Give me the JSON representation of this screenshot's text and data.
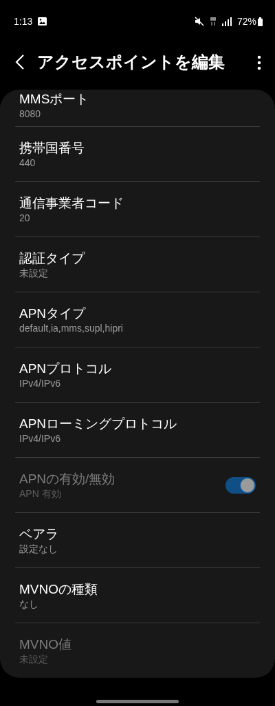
{
  "status_bar": {
    "time": "1:13",
    "battery": "72%"
  },
  "header": {
    "title": "アクセスポイントを編集"
  },
  "items": [
    {
      "kind": "text",
      "label": "MMSポート",
      "value": "8080",
      "disabled": false
    },
    {
      "kind": "text",
      "label": "携帯国番号",
      "value": "440",
      "disabled": false
    },
    {
      "kind": "text",
      "label": "通信事業者コード",
      "value": "20",
      "disabled": false
    },
    {
      "kind": "text",
      "label": "認証タイプ",
      "value": "未設定",
      "disabled": false
    },
    {
      "kind": "text",
      "label": "APNタイプ",
      "value": "default,ia,mms,supl,hipri",
      "disabled": false
    },
    {
      "kind": "text",
      "label": "APNプロトコル",
      "value": "IPv4/IPv6",
      "disabled": false
    },
    {
      "kind": "text",
      "label": "APNローミングプロトコル",
      "value": "IPv4/IPv6",
      "disabled": false
    },
    {
      "kind": "toggle",
      "label": "APNの有効/無効",
      "value": "APN 有効",
      "disabled": true,
      "on": true
    },
    {
      "kind": "text",
      "label": "ベアラ",
      "value": "設定なし",
      "disabled": false
    },
    {
      "kind": "text",
      "label": "MVNOの種類",
      "value": "なし",
      "disabled": false
    },
    {
      "kind": "text",
      "label": "MVNO値",
      "value": "未設定",
      "disabled": true
    }
  ]
}
